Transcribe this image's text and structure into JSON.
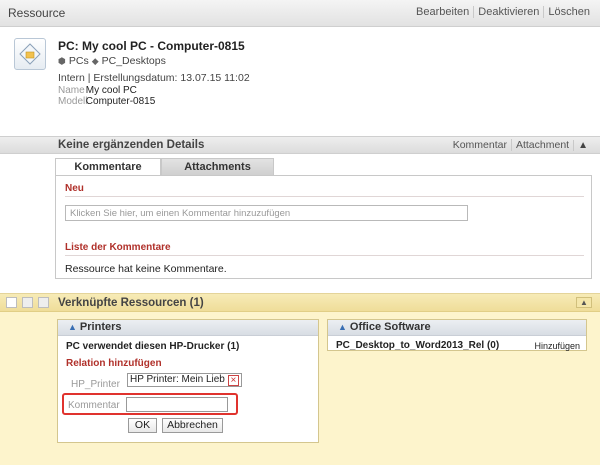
{
  "header": {
    "title": "Ressource",
    "actions": [
      "Bearbeiten",
      "Deaktivieren",
      "Löschen"
    ]
  },
  "resource": {
    "title": "PC: My cool PC - Computer-0815",
    "breadcrumb": [
      "PCs",
      "PC_Desktops"
    ],
    "meta": "Intern | Erstellungsdatum: 13.07.15 11:02",
    "fields": [
      {
        "key": "Name",
        "value": "My cool PC"
      },
      {
        "key": "Modell",
        "value": "Computer-0815"
      }
    ]
  },
  "details": {
    "title": "Keine ergänzenden Details",
    "actions": [
      "Kommentar",
      "Attachment"
    ],
    "tabs": [
      "Kommentare",
      "Attachments"
    ],
    "new_heading": "Neu",
    "comment_placeholder": "Klicken Sie hier, um einen Kommentar hinzuzufügen",
    "list_heading": "Liste der Kommentare",
    "empty_text": "Ressource hat keine Kommentare."
  },
  "linked": {
    "title": "Verknüpfte Ressourcen (1)",
    "printers": {
      "heading": "Printers",
      "relation": "PC verwendet diesen HP-Drucker (1)",
      "add_heading": "Relation hinzufügen",
      "label_printer": "HP_Printer",
      "chip_value": "HP Printer: Mein Lieb",
      "label_comment": "Kommentar",
      "ok": "OK",
      "cancel": "Abbrechen"
    },
    "office": {
      "heading": "Office Software",
      "item": "PC_Desktop_to_Word2013_Rel (0)",
      "add": "Hinzufügen"
    }
  },
  "colors": {
    "accent_red": "#b0302a",
    "highlight_red": "#e0332e",
    "linked_bg": "#fdf4cc",
    "link_blue": "#3a6fb3"
  }
}
